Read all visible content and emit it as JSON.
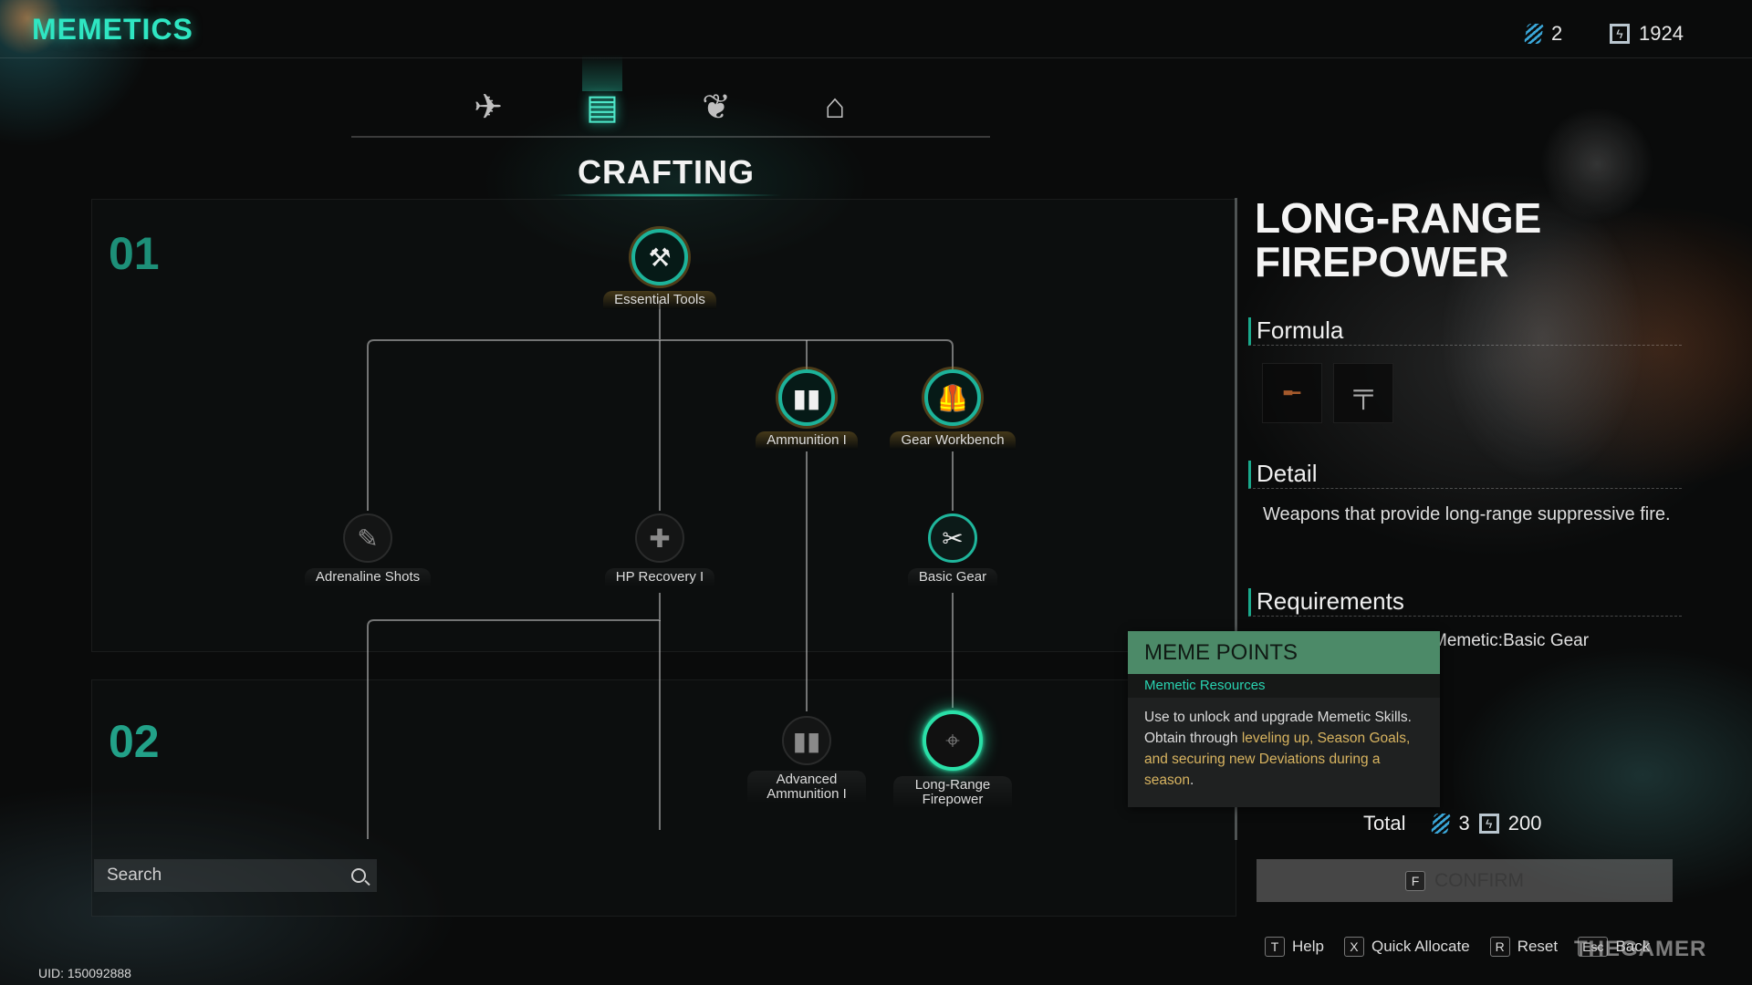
{
  "app": {
    "title": "MEMETICS"
  },
  "currency": {
    "meme_points": "2",
    "energy": "1924"
  },
  "tabs": [
    {
      "name": "combat",
      "icon": "drone-icon",
      "active": false
    },
    {
      "name": "crafting",
      "icon": "workbench-icon",
      "active": true
    },
    {
      "name": "farming",
      "icon": "plant-icon",
      "active": false
    },
    {
      "name": "building",
      "icon": "house-icon",
      "active": false
    }
  ],
  "section": {
    "title": "CRAFTING"
  },
  "tiers": [
    {
      "label": "01"
    },
    {
      "label": "02"
    }
  ],
  "nodes": [
    {
      "id": "essential-tools",
      "label": "Essential Tools",
      "state": "unlocked",
      "glyph": "⚒"
    },
    {
      "id": "ammunition-1",
      "label": "Ammunition I",
      "state": "unlocked",
      "glyph": "▮▮"
    },
    {
      "id": "gear-workbench",
      "label": "Gear Workbench",
      "state": "unlocked",
      "glyph": "🦺"
    },
    {
      "id": "adrenaline-shots",
      "label": "Adrenaline Shots",
      "state": "locked",
      "glyph": "✎"
    },
    {
      "id": "hp-recovery-1",
      "label": "HP Recovery I",
      "state": "locked",
      "glyph": "✚"
    },
    {
      "id": "basic-gear",
      "label": "Basic Gear",
      "state": "available",
      "glyph": "✂"
    },
    {
      "id": "advanced-ammunition-1",
      "label": "Advanced Ammunition I",
      "state": "locked",
      "glyph": "▮▮"
    },
    {
      "id": "long-range-firepower",
      "label": "Long-Range Firepower",
      "state": "selected",
      "glyph": "⌖"
    }
  ],
  "search": {
    "placeholder": "Search",
    "value": ""
  },
  "uid": "UID: 150092888",
  "detail": {
    "title_line1": "LONG-RANGE",
    "title_line2": "FIREPOWER",
    "formula_label": "Formula",
    "formula_items": [
      {
        "name": "sniper-rifle"
      },
      {
        "name": "assault-rifle"
      }
    ],
    "detail_label": "Detail",
    "detail_text": "Weapons that provide long-range suppressive fire.",
    "requirements_label": "Requirements",
    "requirement_text": "Unlock Prerequisite Memetic:Basic Gear",
    "total_label": "Total",
    "total_meme_points": "3",
    "total_energy": "200",
    "confirm_key": "F",
    "confirm_label": "CONFIRM"
  },
  "tooltip": {
    "title": "MEME POINTS",
    "subtitle": "Memetic Resources",
    "body_1": "Use to unlock and upgrade Memetic Skills. Obtain through ",
    "body_hl": "leveling up, Season Goals, and securing new Deviations during a season",
    "body_2": "."
  },
  "hints": [
    {
      "key": "T",
      "label": "Help"
    },
    {
      "key": "X",
      "label": "Quick Allocate"
    },
    {
      "key": "R",
      "label": "Reset"
    },
    {
      "key": "Esc",
      "label": "Back"
    }
  ],
  "watermark": "THEGAMER"
}
